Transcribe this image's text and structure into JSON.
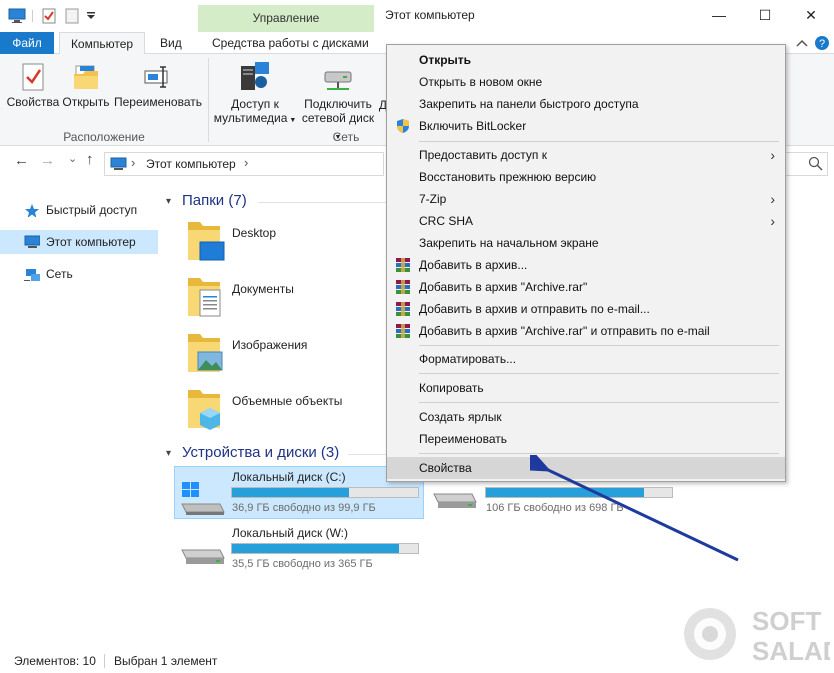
{
  "quick_access_toolbar": {
    "icons": [
      "computer-icon",
      "properties-check-icon",
      "new-folder-icon",
      "customize-dropdown-icon"
    ]
  },
  "titlebar": {
    "context_tab": "Управление",
    "title": "Этот компьютер",
    "min": "—",
    "max": "☐",
    "close": "✕"
  },
  "ribbon_tabs": {
    "file": "Файл",
    "computer": "Компьютер",
    "view": "Вид",
    "drive_tools": "Средства работы с дисками"
  },
  "ribbon": {
    "location_group": {
      "label": "Расположение",
      "properties": "Свойства",
      "open": "Открыть",
      "rename": "Переименовать"
    },
    "network_group": {
      "label": "Сеть",
      "media_line1": "Доступ к",
      "media_line2": "мультимедиа",
      "map_line1": "Подключить",
      "map_line2": "сетевой диск",
      "partial": "Д"
    }
  },
  "address": {
    "path": "Этот компьютер",
    "back": "←",
    "forward": "→",
    "recent": "⌄",
    "up": "↑",
    "sep": "›"
  },
  "nav": {
    "quick_access": "Быстрый доступ",
    "this_pc": "Этот компьютер",
    "network": "Сеть"
  },
  "content": {
    "folders_header": "Папки (7)",
    "folders": [
      "Desktop",
      "Документы",
      "Изображения",
      "Объемные объекты"
    ],
    "drives_header": "Устройства и диски (3)",
    "drives": [
      {
        "name": "Локальный диск (C:)",
        "free": "36,9 ГБ свободно из 99,9 ГБ",
        "used_fraction": 0.63
      },
      {
        "name": "",
        "free": "106 ГБ свободно из 698 ГБ",
        "used_fraction": 0.85
      },
      {
        "name": "Локальный диск (W:)",
        "free": "35,5 ГБ свободно из 365 ГБ",
        "used_fraction": 0.9
      }
    ]
  },
  "statusbar": {
    "items": "Элементов: 10",
    "selected": "Выбран 1 элемент"
  },
  "context_menu": {
    "open": "Открыть",
    "open_new_window": "Открыть в новом окне",
    "pin_quick": "Закрепить на панели быстрого доступа",
    "bitlocker": "Включить BitLocker",
    "share": "Предоставить доступ к",
    "restore": "Восстановить прежнюю версию",
    "zip": "7-Zip",
    "crc": "CRC SHA",
    "pin_start": "Закрепить на начальном экране",
    "add_archive": "Добавить в архив...",
    "add_archive_rar": "Добавить в архив \"Archive.rar\"",
    "add_archive_email": "Добавить в архив и отправить по e-mail...",
    "add_archive_rar_email": "Добавить в архив \"Archive.rar\" и отправить по e-mail",
    "format": "Форматировать...",
    "copy": "Копировать",
    "shortcut": "Создать ярлык",
    "rename": "Переименовать",
    "properties": "Свойства",
    "arrow": "›"
  },
  "watermark": {
    "line1": "SOFT",
    "line2": "SALAD"
  },
  "colors": {
    "accent": "#1979ca",
    "selection": "#cce8ff",
    "bar": "#26a0da",
    "arrow": "#1e3a9e",
    "context_tab": "#d5ecc9"
  }
}
